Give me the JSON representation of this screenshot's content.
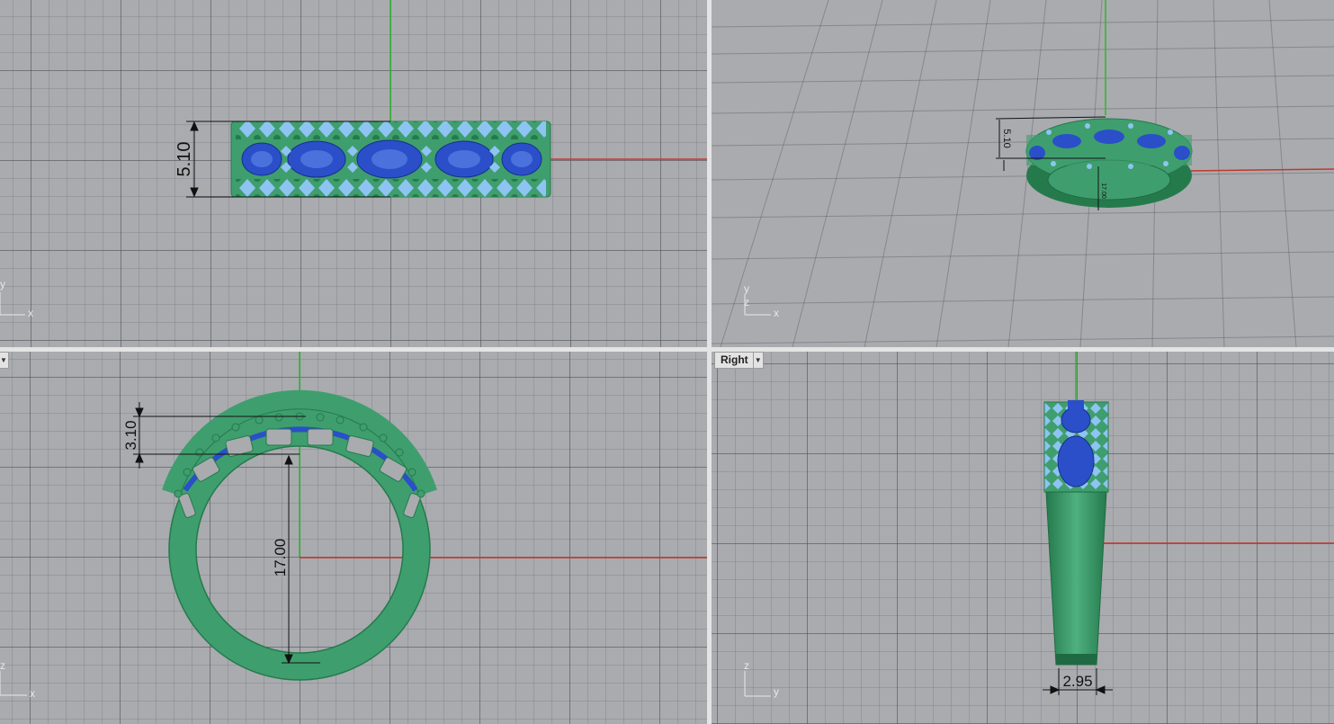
{
  "viewports": {
    "top": {
      "axis_labels": {
        "x": "x",
        "y": "y"
      },
      "dimensions": {
        "height": "5.10"
      }
    },
    "perspective": {
      "axis_labels": {
        "x": "x",
        "y": "y",
        "z": "z"
      },
      "dimensions": {
        "height": "5.10",
        "inner": "17.00"
      }
    },
    "front": {
      "tab_label": "",
      "axis_labels": {
        "x": "x",
        "z": "z"
      },
      "dimensions": {
        "top": "3.10",
        "diameter": "17.00"
      }
    },
    "right": {
      "tab_label": "Right",
      "axis_labels": {
        "y": "y",
        "z": "z"
      },
      "dimensions": {
        "width": "2.95"
      }
    }
  },
  "colors": {
    "viewport_bg": "#a9abaf",
    "ring_metal": "#3f9e6e",
    "ring_metal_dark": "#257a4c",
    "stone_blue": "#2a4fc9",
    "stone_light": "#8ec4f2",
    "x_axis": "#c0392b",
    "y_axis": "#2db82d"
  }
}
